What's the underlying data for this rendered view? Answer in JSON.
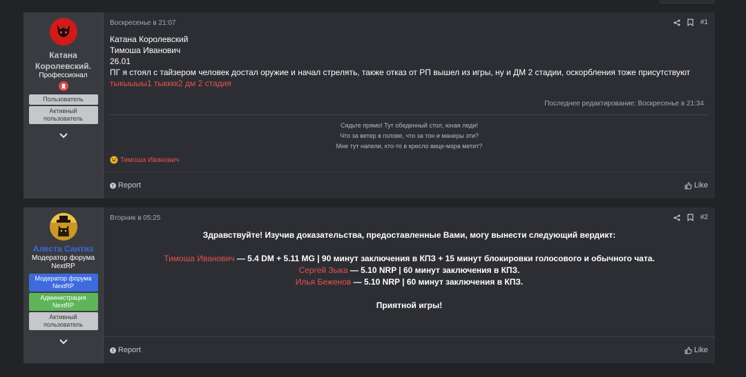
{
  "posts": [
    {
      "author": "Катана Королевский.",
      "user_title": "Профессионал",
      "banners": [
        "Пользователь",
        "Активный пользователь"
      ],
      "date": "Воскресенье в 21:07",
      "number": "#1",
      "lines": [
        "Катана Королевский",
        "Тимоша Иванович",
        "26.01",
        "ПГ я стоял с тайзером человек достал оружие и начал стрелять, также отказ от РП вышел из игры, ну и ДМ 2 стадии, оскорбления тоже присутствуют"
      ],
      "red_line": "тыкыыыы1 тыкккк2 дм 2 стадия",
      "edited": "Последнее редактирование: Воскресенье в 21:34",
      "signature": [
        "Сядьте прямо! Тут обеденный стол, юная леди!",
        "Что за ветер в голове, что за тон и манеры эти?",
        "Мне тут напели, кто-то в кресло вице-мэра метит?"
      ],
      "reaction_user": "Тимоша Иванович",
      "report_label": "Report",
      "like_label": "Like"
    },
    {
      "author": "Алеста Сантиз",
      "user_title": "Модератор форума NextRP",
      "banners": [
        "Модератор форума NextRP",
        "Администрация NextRP",
        "Активный пользователь"
      ],
      "date": "Вторник в 05:25",
      "number": "#2",
      "greeting": "Здравствуйте! Изучив доказательства, предоставленные Вами, могу вынести следующий вердикт:",
      "verdicts": [
        {
          "name": "Тимоша Иванович",
          "text": " — 5.4 DM + 5.11 MG | 90 минут заключения в КПЗ + 15 минут блокировки голосового и обычного чата."
        },
        {
          "name": "Сергей Зыка",
          "text": " — 5.10 NRP | 60 минут заключения в КПЗ."
        },
        {
          "name": "Илья Беженов",
          "text": " — 5.10 NRP | 60 минут заключения в КПЗ."
        }
      ],
      "closing": "Приятной игры!",
      "report_label": "Report",
      "like_label": "Like"
    }
  ],
  "colors": {
    "background": "#222326",
    "post": "#2d2e33",
    "sidebar": "#3a3b40",
    "accent_red": "#e5524f",
    "moderator_blue": "#3d6bdc",
    "admin_green": "#5fb55a"
  },
  "icons": [
    "share-icon",
    "bookmark-icon",
    "chevron-down-icon",
    "report-icon",
    "like-icon",
    "laugh-reaction-icon",
    "devil-avatar",
    "cat-avatar",
    "award-badge-icon"
  ]
}
